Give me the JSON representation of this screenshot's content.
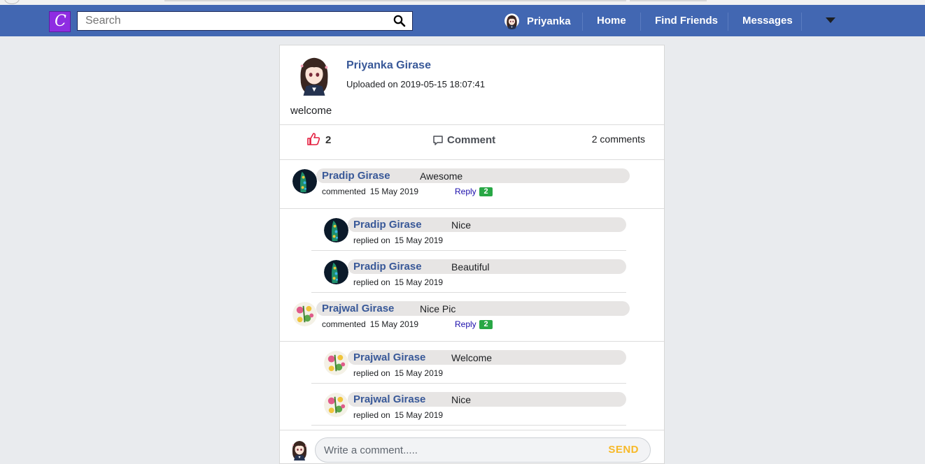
{
  "navbar": {
    "logo_letter": "C",
    "search_placeholder": "Search",
    "user_name": "Priyanka",
    "links": [
      "Home",
      "Find Friends",
      "Messages"
    ],
    "color": "#4267b2"
  },
  "post": {
    "author": "Priyanka Girase",
    "uploaded": "Uploaded on 2019-05-15 18:07:41",
    "text": "welcome",
    "likes": "2",
    "comment_label": "Comment",
    "comments_count": "2 comments"
  },
  "comments": [
    {
      "author": "Pradip Girase",
      "text": "Awesome",
      "meta": "commented",
      "date": "15 May 2019",
      "reply_label": "Reply",
      "reply_count": "2",
      "replies": [
        {
          "author": "Pradip Girase",
          "text": "Nice",
          "meta": "replied on",
          "date": "15 May 2019"
        },
        {
          "author": "Pradip Girase",
          "text": "Beautiful",
          "meta": "replied on",
          "date": "15 May 2019"
        }
      ]
    },
    {
      "author": "Prajwal Girase",
      "text": "Nice Pic",
      "meta": "commented",
      "date": "15 May 2019",
      "reply_label": "Reply",
      "reply_count": "2",
      "replies": [
        {
          "author": "Prajwal Girase",
          "text": "Welcome",
          "meta": "replied on",
          "date": "15 May 2019"
        },
        {
          "author": "Prajwal Girase",
          "text": "Nice",
          "meta": "replied on",
          "date": "15 May 2019"
        }
      ]
    }
  ],
  "composer": {
    "placeholder": "Write a comment.....",
    "send_label": "SEND"
  },
  "icons": [
    "search-icon",
    "like-icon",
    "comment-icon",
    "dropdown-caret-icon"
  ],
  "colors": {
    "link": "#385898",
    "like": "#e41e3f",
    "send": "#f7b928",
    "badge": "#28a745"
  }
}
